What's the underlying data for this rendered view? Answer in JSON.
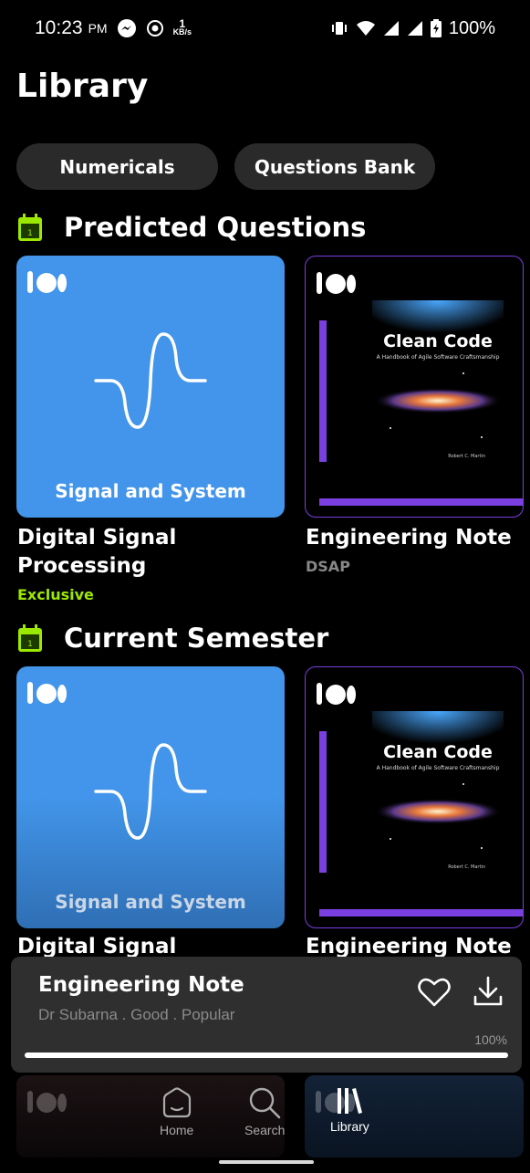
{
  "status_bar": {
    "time": "10:23",
    "ampm": "PM",
    "net_speed_value": "1",
    "net_speed_unit": "KB/s",
    "battery": "100%"
  },
  "page_title": "Library",
  "chips": [
    "Numericals",
    "Questions Bank"
  ],
  "sections": [
    {
      "title": "Predicted Questions",
      "cards": [
        {
          "cover_label": "Signal and System",
          "title_line1": "Digital Signal",
          "title_line2": "Processing",
          "tag": "Exclusive"
        },
        {
          "book_title": "Clean Code",
          "book_subtitle": "A Handbook of Agile Software Craftsmanship",
          "book_author": "Robert C. Martin",
          "title_line1": "Engineering Note",
          "subtitle": "DSAP"
        }
      ]
    },
    {
      "title": "Current Semester",
      "cards": [
        {
          "cover_label": "Signal and System",
          "title_line1": "Digital Signal"
        },
        {
          "book_title": "Clean Code",
          "book_subtitle": "A Handbook of Agile Software Craftsmanship",
          "book_author": "Robert C. Martin",
          "title_line1": "Engineering Note"
        }
      ]
    }
  ],
  "player": {
    "title": "Engineering Note",
    "subtitle": "Dr Subarna . Good . Popular",
    "progress_label": "100%",
    "progress": 1.0
  },
  "nav": {
    "home": "Home",
    "search": "Search",
    "library": "Library"
  },
  "colors": {
    "accent_green": "#9be800",
    "card_blue": "#4295ea",
    "card_purple": "#7a3fe0"
  }
}
